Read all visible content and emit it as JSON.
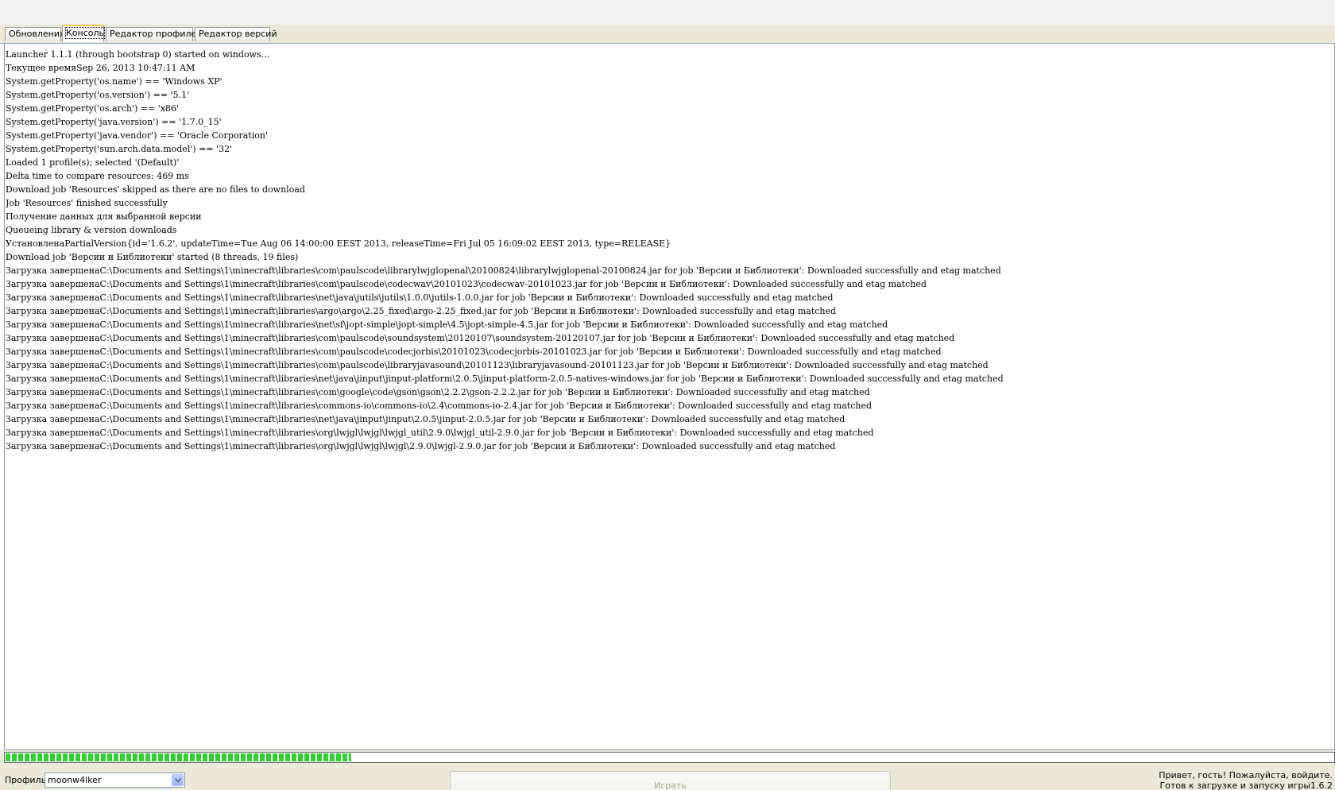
{
  "tabs": [
    {
      "label": "Обновления",
      "active": false
    },
    {
      "label": "Консоль",
      "active": true
    },
    {
      "label": "Редактор профилей",
      "active": false
    },
    {
      "label": "Редактор версий",
      "active": false
    }
  ],
  "console": {
    "lines": [
      "Launcher 1.1.1 (through bootstrap 0) started on windows...",
      "Текущее времяSep 26, 2013 10:47:11 AM",
      "System.getProperty('os.name') == 'Windows XP'",
      "System.getProperty('os.version') == '5.1'",
      "System.getProperty('os.arch') == 'x86'",
      "System.getProperty('java.version') == '1.7.0_15'",
      "System.getProperty('java.vendor') == 'Oracle Corporation'",
      "System.getProperty('sun.arch.data.model') == '32'",
      "Loaded 1 profile(s); selected '(Default)'",
      "Delta time to compare resources: 469 ms",
      "Download job 'Resources' skipped as there are no files to download",
      "Job 'Resources' finished successfully",
      "Получение данных для выбранной версии",
      "Queueing library & version downloads",
      "УстановленаPartialVersion{id='1.6.2', updateTime=Tue Aug 06 14:00:00 EEST 2013, releaseTime=Fri Jul 05 16:09:02 EEST 2013, type=RELEASE}",
      "Download job 'Версии и Библиотеки' started (8 threads, 19 files)",
      "Загрузка завершенаC:\\Documents and Settings\\1\\minecraft\\libraries\\com\\paulscode\\librarylwjglopenal\\20100824\\librarylwjglopenal-20100824.jar for job 'Версии и Библиотеки': Downloaded successfully and etag matched",
      "Загрузка завершенаC:\\Documents and Settings\\1\\minecraft\\libraries\\com\\paulscode\\codecwav\\20101023\\codecwav-20101023.jar for job 'Версии и Библиотеки': Downloaded successfully and etag matched",
      "Загрузка завершенаC:\\Documents and Settings\\1\\minecraft\\libraries\\net\\java\\jutils\\jutils\\1.0.0\\jutils-1.0.0.jar for job 'Версии и Библиотеки': Downloaded successfully and etag matched",
      "Загрузка завершенаC:\\Documents and Settings\\1\\minecraft\\libraries\\argo\\argo\\2.25_fixed\\argo-2.25_fixed.jar for job 'Версии и Библиотеки': Downloaded successfully and etag matched",
      "Загрузка завершенаC:\\Documents and Settings\\1\\minecraft\\libraries\\net\\sf\\jopt-simple\\jopt-simple\\4.5\\jopt-simple-4.5.jar for job 'Версии и Библиотеки': Downloaded successfully and etag matched",
      "Загрузка завершенаC:\\Documents and Settings\\1\\minecraft\\libraries\\com\\paulscode\\soundsystem\\20120107\\soundsystem-20120107.jar for job 'Версии и Библиотеки': Downloaded successfully and etag matched",
      "Загрузка завершенаC:\\Documents and Settings\\1\\minecraft\\libraries\\com\\paulscode\\codecjorbis\\20101023\\codecjorbis-20101023.jar for job 'Версии и Библиотеки': Downloaded successfully and etag matched",
      "Загрузка завершенаC:\\Documents and Settings\\1\\minecraft\\libraries\\com\\paulscode\\libraryjavasound\\20101123\\libraryjavasound-20101123.jar for job 'Версии и Библиотеки': Downloaded successfully and etag matched",
      "Загрузка завершенаC:\\Documents and Settings\\1\\minecraft\\libraries\\net\\java\\jinput\\jinput-platform\\2.0.5\\jinput-platform-2.0.5-natives-windows.jar for job 'Версии и Библиотеки': Downloaded successfully and etag matched",
      "Загрузка завершенаC:\\Documents and Settings\\1\\minecraft\\libraries\\com\\google\\code\\gson\\gson\\2.2.2\\gson-2.2.2.jar for job 'Версии и Библиотеки': Downloaded successfully and etag matched",
      "Загрузка завершенаC:\\Documents and Settings\\1\\minecraft\\libraries\\commons-io\\commons-io\\2.4\\commons-io-2.4.jar for job 'Версии и Библиотеки': Downloaded successfully and etag matched",
      "Загрузка завершенаC:\\Documents and Settings\\1\\minecraft\\libraries\\net\\java\\jinput\\jinput\\2.0.5\\jinput-2.0.5.jar for job 'Версии и Библиотеки': Downloaded successfully and etag matched",
      "Загрузка завершенаC:\\Documents and Settings\\1\\minecraft\\libraries\\org\\lwjgl\\lwjgl\\lwjgl_util\\2.9.0\\lwjgl_util-2.9.0.jar for job 'Версии и Библиотеки': Downloaded successfully and etag matched",
      "Загрузка завершенаC:\\Documents and Settings\\1\\minecraft\\libraries\\org\\lwjgl\\lwjgl\\lwjgl\\2.9.0\\lwjgl-2.9.0.jar for job 'Версии и Библиотеки': Downloaded successfully and etag matched"
    ]
  },
  "progress": {
    "fraction": 0.26
  },
  "bottom": {
    "profile_label": "Профиль:",
    "profile_value": "moonw4lker",
    "play_label": "Играть",
    "status_line1": "Привет, гость! Пожалуйста, войдите.",
    "status_line2": "Готов к загрузке и запуску игры1.6.2"
  },
  "colors": {
    "progress_green": "#2fd22f",
    "active_tab_accent": "#ffc83c",
    "chrome_bg": "#ece9d8"
  }
}
